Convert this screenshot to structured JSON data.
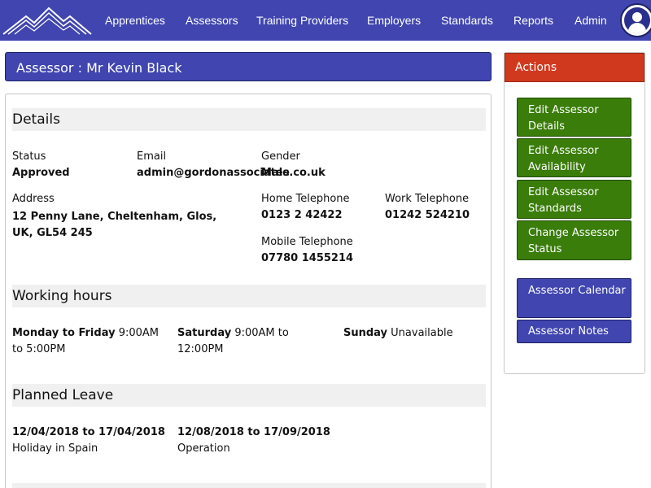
{
  "nav": {
    "items": [
      "Apprentices",
      "Assessors",
      "Training Providers",
      "Employers",
      "Standards",
      "Reports",
      "Admin"
    ]
  },
  "header": {
    "title": "Assessor : Mr Kevin Black"
  },
  "details": {
    "heading": "Details",
    "status_label": "Status",
    "status_value": "Approved",
    "email_label": "Email",
    "email_value": "admin@gordonassociates.co.uk",
    "gender_label": "Gender",
    "gender_value": "Male",
    "address_label": "Address",
    "address_value": "12 Penny Lane, Cheltenham, Glos, UK, GL54 245",
    "home_tel_label": "Home Telephone",
    "home_tel_value": "0123 2 42422",
    "work_tel_label": "Work Telephone",
    "work_tel_value": "01242 524210",
    "mobile_tel_label": "Mobile Telephone",
    "mobile_tel_value": "07780 1455214"
  },
  "working_hours": {
    "heading": "Working hours",
    "entries": [
      {
        "day": "Monday to Friday",
        "time": "9:00AM to 5:00PM"
      },
      {
        "day": "Saturday",
        "time": "9:00AM to 12:00PM"
      },
      {
        "day": "Sunday",
        "time": "Unavailable"
      }
    ]
  },
  "planned_leave": {
    "heading": "Planned Leave",
    "entries": [
      {
        "dates": "12/04/2018 to 17/04/2018",
        "reason": "Holiday in Spain"
      },
      {
        "dates": "12/08/2018 to 17/09/2018",
        "reason": "Operation"
      }
    ]
  },
  "actions": {
    "heading": "Actions",
    "edit_details": "Edit Assessor Details",
    "edit_availability": "Edit Assessor Availability",
    "edit_standards": "Edit Assessor Standards",
    "change_status": "Change Assessor Status",
    "calendar": "Assessor Calendar",
    "notes": "Assessor Notes"
  },
  "colors": {
    "nav_bg": "#4045b0",
    "actions_header": "#d0391e",
    "green_button": "#3a7d0a",
    "blue_button": "#4045b0"
  }
}
